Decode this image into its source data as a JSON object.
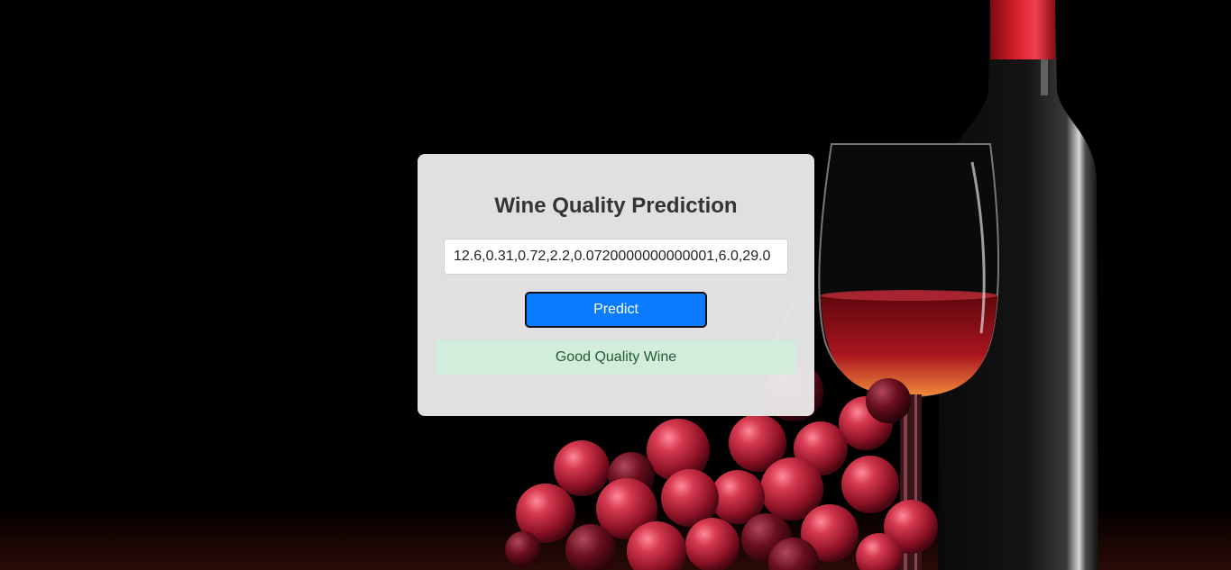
{
  "background": {
    "description_icon": "wine-bottle-glass-grapes-photo",
    "colors": {
      "base": "#000000",
      "grape": "#b11f35",
      "wine": "#a8151f",
      "foil": "#d51e2a"
    }
  },
  "form": {
    "title": "Wine Quality Prediction",
    "input_value": "12.6,0.31,0.72,2.2,0.0720000000000001,6.0,29.0",
    "predict_label": "Predict",
    "result_text": "Good Quality Wine"
  },
  "colors": {
    "card_bg": "#ececec",
    "button_bg": "#0a7bff",
    "result_bg": "#d2eedb",
    "result_text": "#225c33"
  }
}
